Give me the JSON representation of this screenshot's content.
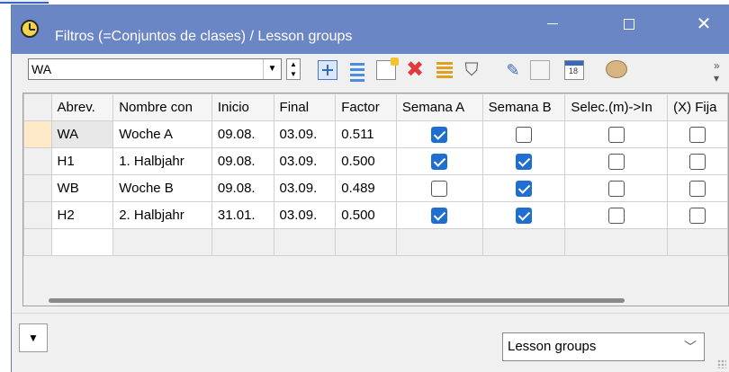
{
  "window": {
    "title": "Filtros (=Conjuntos de clases) / Lesson groups",
    "min_label": "",
    "max_label": "",
    "close_label": "✕"
  },
  "toolbar": {
    "selector_value": "WA",
    "icons": [
      "add-row-icon",
      "list-icon",
      "new-item-icon",
      "delete-icon",
      "sort-icon",
      "filter-icon",
      "format-icon",
      "grid-icon",
      "calendar-icon",
      "palette-icon",
      "more-icon"
    ]
  },
  "table": {
    "columns": [
      "Abrev.",
      "Nombre con",
      "Inicio",
      "Final",
      "Factor",
      "Semana A",
      "Semana B",
      "Selec.(m)->In",
      "(X) Fija"
    ],
    "rows": [
      {
        "abrev": "WA",
        "nombre": "Woche A",
        "inicio": "09.08.",
        "final": "03.09.",
        "factor": "0.511",
        "semana_a": true,
        "semana_b": false,
        "selec": false,
        "fija": false
      },
      {
        "abrev": "H1",
        "nombre": "1. Halbjahr",
        "inicio": "09.08.",
        "final": "03.09.",
        "factor": "0.500",
        "semana_a": true,
        "semana_b": true,
        "selec": false,
        "fija": false
      },
      {
        "abrev": "WB",
        "nombre": "Woche B",
        "inicio": "09.08.",
        "final": "03.09.",
        "factor": "0.489",
        "semana_a": false,
        "semana_b": true,
        "selec": false,
        "fija": false
      },
      {
        "abrev": "H2",
        "nombre": "2. Halbjahr",
        "inicio": "31.01.",
        "final": "03.09.",
        "factor": "0.500",
        "semana_a": true,
        "semana_b": true,
        "selec": false,
        "fija": false
      }
    ],
    "selected_row": 0
  },
  "footer": {
    "view_select_value": "Lesson groups"
  },
  "colors": {
    "titlebar": "#6b86c4",
    "checkbox_on": "#1f6fd0",
    "selected_rowhead": "#fde8c8"
  }
}
